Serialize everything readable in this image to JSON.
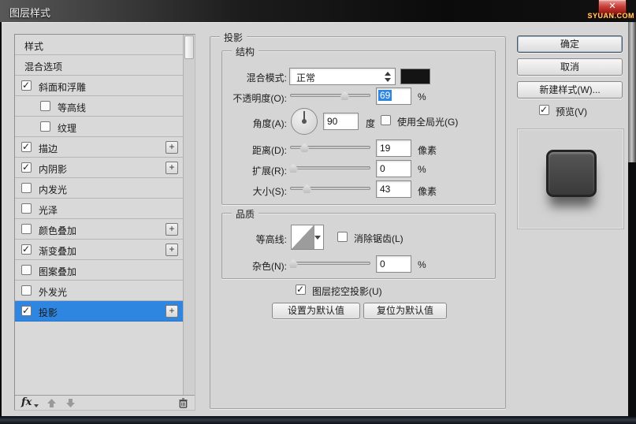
{
  "window": {
    "title": "图层样式",
    "close_glyph": "✕",
    "watermark": "SYUAN.COM"
  },
  "sidebar": {
    "items": [
      {
        "label": "样式"
      },
      {
        "label": "混合选项"
      },
      {
        "label": "斜面和浮雕",
        "checked": true
      },
      {
        "label": "等高线",
        "checked": false
      },
      {
        "label": "纹理",
        "checked": false
      },
      {
        "label": "描边",
        "checked": true,
        "plus": "+"
      },
      {
        "label": "内阴影",
        "checked": true,
        "plus": "+"
      },
      {
        "label": "内发光",
        "checked": false
      },
      {
        "label": "光泽",
        "checked": false
      },
      {
        "label": "颜色叠加",
        "checked": false,
        "plus": "+"
      },
      {
        "label": "渐变叠加",
        "checked": true,
        "plus": "+"
      },
      {
        "label": "图案叠加",
        "checked": false
      },
      {
        "label": "外发光",
        "checked": false
      },
      {
        "label": "投影",
        "checked": true,
        "plus": "+",
        "selected": true
      }
    ],
    "toolbar": {
      "fx": "fx"
    }
  },
  "panel": {
    "title": "投影",
    "structure": {
      "legend": "结构",
      "blend_mode_label": "混合模式:",
      "blend_mode_value": "正常",
      "opacity_label": "不透明度(O):",
      "opacity_value": "69",
      "opacity_unit": "%",
      "angle_label": "角度(A):",
      "angle_value": "90",
      "angle_unit": "度",
      "global_light_label": "使用全局光(G)",
      "distance_label": "距离(D):",
      "distance_value": "19",
      "distance_unit": "像素",
      "spread_label": "扩展(R):",
      "spread_value": "0",
      "spread_unit": "%",
      "size_label": "大小(S):",
      "size_value": "43",
      "size_unit": "像素"
    },
    "quality": {
      "legend": "品质",
      "contour_label": "等高线:",
      "antialias_label": "消除锯齿(L)",
      "noise_label": "杂色(N):",
      "noise_value": "0",
      "noise_unit": "%"
    },
    "knockout_label": "图层挖空投影(U)",
    "set_default_label": "设置为默认值",
    "reset_default_label": "复位为默认值"
  },
  "actions": {
    "ok": "确定",
    "cancel": "取消",
    "new_style": "新建样式(W)...",
    "preview": "预览(V)"
  },
  "colors": {
    "selection": "#2f86e0",
    "blend_swatch": "#141414",
    "accent_red": "#b42318"
  }
}
